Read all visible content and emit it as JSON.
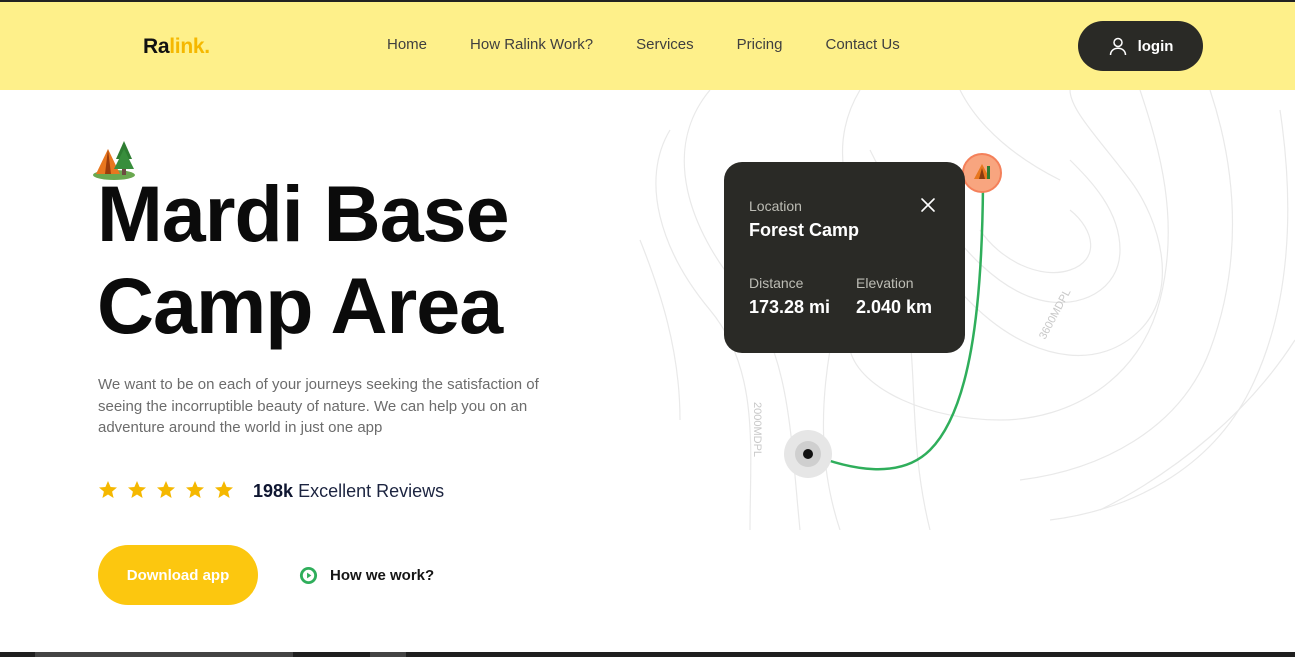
{
  "brand": {
    "part1": "Ra",
    "part2": "link.",
    "accent": "#f5b800"
  },
  "nav": [
    "Home",
    "How Ralink Work?",
    "Services",
    "Pricing",
    "Contact Us"
  ],
  "login_label": "login",
  "hero": {
    "title_line1": "Mardi Base",
    "title_line2": "Camp Area",
    "description": "We want to be on each of your journeys seeking the satisfaction of seeing the incorruptible beauty of nature. We can help you on an adventure around the world in just one app",
    "rating_stars": 5,
    "reviews_count": "198k",
    "reviews_label": "Excellent Reviews",
    "download_label": "Download app",
    "how_label": "How we work?"
  },
  "card": {
    "location_label": "Location",
    "location_value": "Forest Camp",
    "distance_label": "Distance",
    "distance_value": "173.28 mi",
    "elevation_label": "Elevation",
    "elevation_value": "2.040 km"
  },
  "map": {
    "contour_label_1": "3600MDPL",
    "contour_label_2": "2000MDPL"
  },
  "colors": {
    "header_bg": "#fef08a",
    "dark": "#2a2a26",
    "yellow": "#fcc70f",
    "route": "#2fae5b",
    "pin": "#f5845f",
    "star": "#f5b800"
  }
}
